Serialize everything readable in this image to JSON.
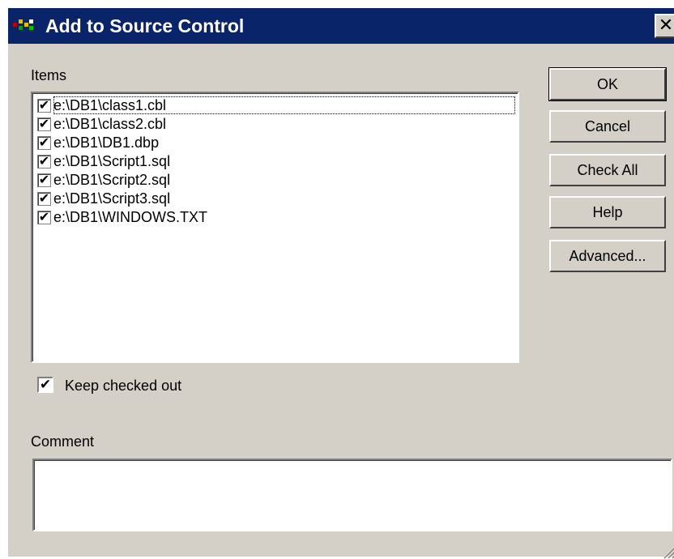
{
  "window": {
    "title": "Add to Source Control",
    "close_glyph": "✕"
  },
  "items": {
    "label": "Items",
    "entries": [
      {
        "path": "e:\\DB1\\class1.cbl",
        "checked": true
      },
      {
        "path": "e:\\DB1\\class2.cbl",
        "checked": true
      },
      {
        "path": "e:\\DB1\\DB1.dbp",
        "checked": true
      },
      {
        "path": "e:\\DB1\\Script1.sql",
        "checked": true
      },
      {
        "path": "e:\\DB1\\Script2.sql",
        "checked": true
      },
      {
        "path": "e:\\DB1\\Script3.sql",
        "checked": true
      },
      {
        "path": "e:\\DB1\\WINDOWS.TXT",
        "checked": true
      }
    ]
  },
  "buttons": {
    "ok": "OK",
    "cancel": "Cancel",
    "check_all": "Check All",
    "help": "Help",
    "advanced": "Advanced..."
  },
  "keep_checked_out": {
    "label": "Keep checked out",
    "checked": true
  },
  "comment": {
    "label": "Comment",
    "value": ""
  },
  "icons": {
    "app": "source-control-app-icon",
    "close": "close-icon",
    "check": "checkmark-icon",
    "grip": "resize-grip-icon"
  },
  "colors": {
    "titlebar": "#0a246a",
    "face": "#d4d0c8"
  }
}
